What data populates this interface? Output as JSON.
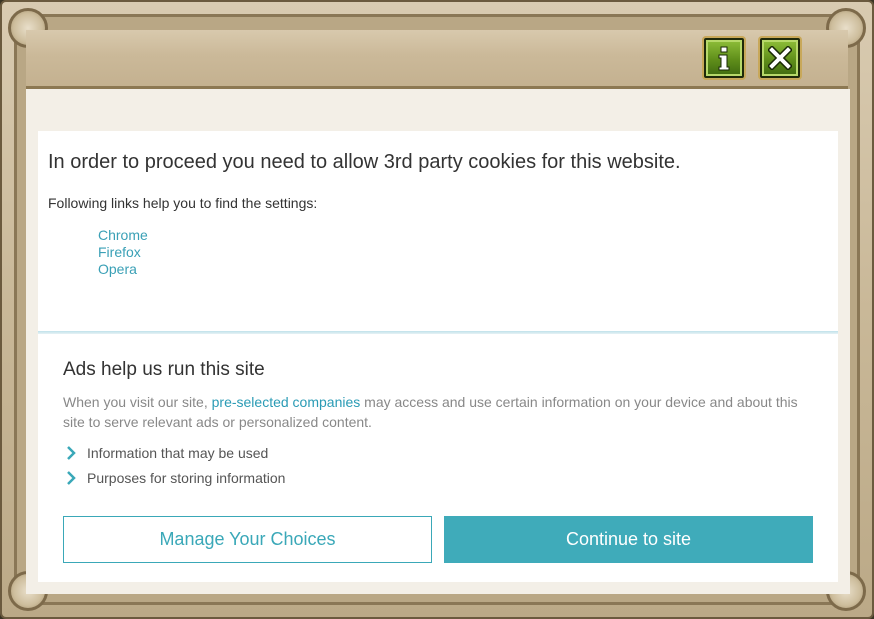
{
  "window": {
    "info_icon": "info-icon",
    "close_icon": "close-icon"
  },
  "cookie_notice": {
    "message": "In order to proceed you need to allow 3rd party cookies for this website.",
    "subtext": "Following links help you to find the settings:",
    "links": [
      "Chrome",
      "Firefox",
      "Opera"
    ]
  },
  "consent": {
    "heading": "Ads help us run this site",
    "text_before": "When you visit our site, ",
    "link": "pre-selected companies",
    "text_after": " may access and use certain information on your device and about this site to serve relevant ads or personalized content.",
    "disclosures": [
      "Information that may be used",
      "Purposes for storing information"
    ],
    "manage_label": "Manage Your Choices",
    "continue_label": "Continue to site"
  },
  "colors": {
    "accent": "#3fabba",
    "link": "#3aa0b6",
    "frame": "#c9b898",
    "button_green": "#5f8e1a"
  }
}
